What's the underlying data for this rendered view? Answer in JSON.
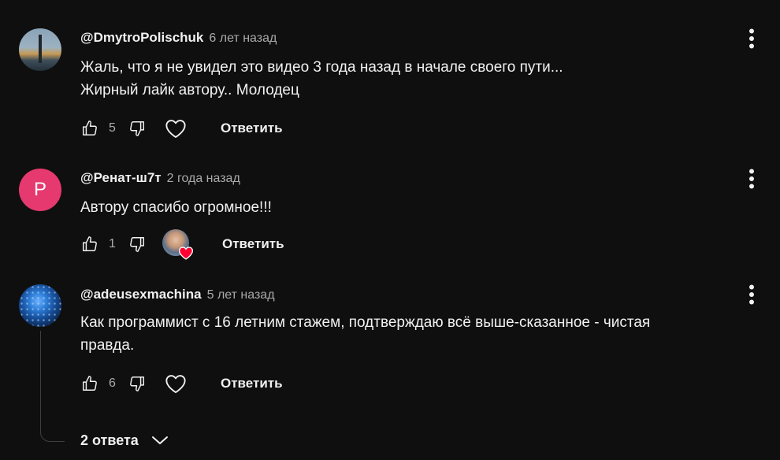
{
  "comments": [
    {
      "author": "@DmytroPolischuk",
      "time": "6 лет назад",
      "lines": [
        "Жаль, что я не увидел это видео 3 года назад в начале своего пути...",
        "Жирный лайк автору.. Молодец"
      ],
      "likes": "5",
      "reply_label": "Ответить",
      "avatar_icon": "user-photo"
    },
    {
      "author": "@Ренат-ш7т",
      "time": "2 года назад",
      "lines": [
        "Автору спасибо огромное!!!"
      ],
      "likes": "1",
      "reply_label": "Ответить",
      "avatar_letter": "Р",
      "avatar_color": "#e5396f",
      "creator_heart": true
    },
    {
      "author": "@adeusexmachina",
      "time": "5 лет назад",
      "lines": [
        "Как программист с 16 летним стажем, подтверждаю всё выше-сказанное - чистая",
        "правда."
      ],
      "likes": "6",
      "reply_label": "Ответить",
      "avatar_icon": "user-photo"
    }
  ],
  "replies_toggle": {
    "label": "2 ответа",
    "icon": "chevron-down-icon"
  },
  "colors": {
    "background": "#0f0f0f",
    "text": "#f1f1f1",
    "secondary": "#aaaaaa",
    "heart_red": "#ff0033"
  }
}
